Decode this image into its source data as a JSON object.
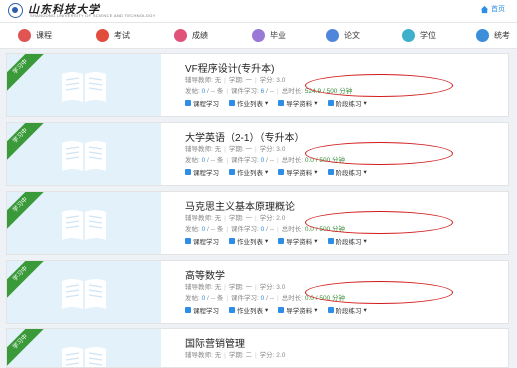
{
  "header": {
    "logo_title": "山东科技大学",
    "logo_sub": "SHANDONG UNIVERSITY OF SCIENCE AND TECHNOLOGY",
    "home_label": "首页"
  },
  "nav": [
    {
      "label": "课程",
      "icon": "course-icon",
      "color": "#e05454"
    },
    {
      "label": "考试",
      "icon": "exam-icon",
      "color": "#e14d3d"
    },
    {
      "label": "成绩",
      "icon": "grade-icon",
      "color": "#e0527a"
    },
    {
      "label": "毕业",
      "icon": "graduation-icon",
      "color": "#9a79d6"
    },
    {
      "label": "论文",
      "icon": "thesis-icon",
      "color": "#4f86d9"
    },
    {
      "label": "学位",
      "icon": "degree-icon",
      "color": "#3eb0c9"
    },
    {
      "label": "统考",
      "icon": "unified-exam-icon",
      "color": "#3b8ed8"
    }
  ],
  "labels": {
    "teacher": "辅导教师: ",
    "term": "学期: ",
    "credit": "学分: ",
    "posts": "发帖: ",
    "study": "课件学习: ",
    "total": "总时长: ",
    "unit_item": " 条",
    "unit_time": " 分钟",
    "act_study": "课程学习",
    "act_homework": "作业列表",
    "act_guide": "导学资料",
    "act_practice": "阶段练习"
  },
  "ribbon": "学习中",
  "courses": [
    {
      "title": "VF程序设计(专升本)",
      "teacher": "无",
      "term": "一",
      "credit": "3.0",
      "posts_done": "0",
      "posts_total": "--",
      "study_done": "6",
      "study_total": "--",
      "total_done": "524.9",
      "total_req": "500"
    },
    {
      "title": "大学英语（2-1）（专升本）",
      "teacher": "无",
      "term": "一",
      "credit": "3.0",
      "posts_done": "0",
      "posts_total": "--",
      "study_done": "0",
      "study_total": "--",
      "total_done": "0.0",
      "total_req": "500"
    },
    {
      "title": "马克思主义基本原理概论",
      "teacher": "无",
      "term": "一",
      "credit": "2.0",
      "posts_done": "0",
      "posts_total": "--",
      "study_done": "0",
      "study_total": "--",
      "total_done": "0.0",
      "total_req": "500"
    },
    {
      "title": "高等数学",
      "teacher": "无",
      "term": "一",
      "credit": "3.0",
      "posts_done": "0",
      "posts_total": "--",
      "study_done": "0",
      "study_total": "--",
      "total_done": "0.0",
      "total_req": "500"
    },
    {
      "title": "国际营销管理",
      "teacher": "无",
      "term": "二",
      "credit": "2.0",
      "posts_done": "",
      "posts_total": "",
      "study_done": "",
      "study_total": "",
      "total_done": "",
      "total_req": ""
    }
  ]
}
